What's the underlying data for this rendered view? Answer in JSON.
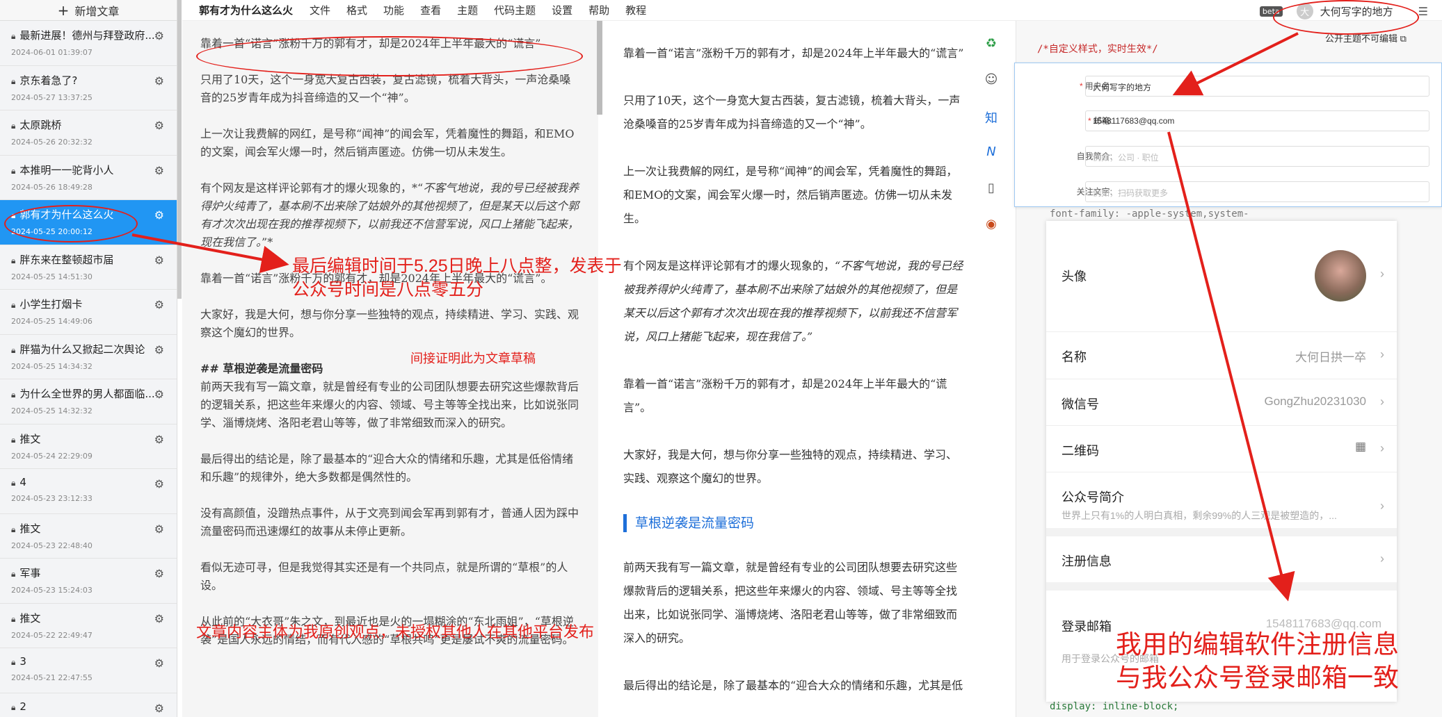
{
  "sidebar": {
    "new_article": "新增文章",
    "items": [
      {
        "title": "最新进展！德州与拜登政府...",
        "date": "2024-06-01 01:39:07",
        "active": false
      },
      {
        "title": "京东着急了?",
        "date": "2024-05-27 13:37:25",
        "active": false
      },
      {
        "title": "太原跳桥",
        "date": "2024-05-26 20:32:32",
        "active": false
      },
      {
        "title": "本推明一一驼背小人",
        "date": "2024-05-26 18:49:28",
        "active": false
      },
      {
        "title": "郭有才为什么这么火",
        "date": "2024-05-25 20:00:12",
        "active": true
      },
      {
        "title": "胖东来在整顿超市届",
        "date": "2024-05-25 14:51:30",
        "active": false
      },
      {
        "title": "小学生打烟卡",
        "date": "2024-05-25 14:49:06",
        "active": false
      },
      {
        "title": "胖猫为什么又掀起二次舆论",
        "date": "2024-05-25 14:34:32",
        "active": false
      },
      {
        "title": "为什么全世界的男人都面临...",
        "date": "2024-05-25 14:32:32",
        "active": false
      },
      {
        "title": "推文",
        "date": "2024-05-24 22:29:09",
        "active": false
      },
      {
        "title": "4",
        "date": "2024-05-23 23:12:33",
        "active": false
      },
      {
        "title": "推文",
        "date": "2024-05-23 22:48:40",
        "active": false
      },
      {
        "title": "军事",
        "date": "2024-05-23 15:24:03",
        "active": false
      },
      {
        "title": "推文",
        "date": "2024-05-22 22:49:47",
        "active": false
      },
      {
        "title": "3",
        "date": "2024-05-21 22:47:55",
        "active": false
      },
      {
        "title": "2",
        "date": "",
        "active": false
      }
    ]
  },
  "menubar": {
    "doc_title": "郭有才为什么这么火",
    "menus": [
      "文件",
      "格式",
      "功能",
      "查看",
      "主题",
      "代码主题",
      "设置",
      "帮助",
      "教程"
    ],
    "beta": "beta",
    "avatar_char": "大",
    "username": "大何写字的地方"
  },
  "editor": {
    "p1": "靠着一首“诺言”涨粉千万的郭有才，却是2024年上半年最大的“谎言”",
    "p2": "只用了10天，这个一身宽大复古西装，复古滤镜，梳着大背头，一声沧桑嗓音的25岁青年成为抖音缔造的又一个“神”。",
    "p3": "上一次让我费解的网红，是号称“闻神”的闻会军，凭着魔性的舞蹈，和EMO的文案，闻会军火爆一时，然后销声匿迹。仿佛一切从未发生。",
    "p4a": "有个网友是这样评论郭有才的爆火现象的，*“",
    "p4b": "不客气地说，我的号已经被我养得炉火纯青了，基本刷不出来除了姑娘外的其他视频了，但是某天以后这个郭有才次次出现在我的推荐视频下，以前我还不信营军说，风口上猪能飞起来，现在我信了。",
    "p4c": "”*",
    "p5": "靠着一首“诺言”涨粉千万的郭有才，却是2024年上半年最大的“谎言”。",
    "p6": "大家好，我是大何，想与你分享一些独特的观点，持续精进、学习、实践、观察这个魔幻的世界。",
    "h2": "##  草根逆袭是流量密码",
    "p7": "前两天我有写一篇文章，就是曾经有专业的公司团队想要去研究这些爆款背后的逻辑关系，把这些年来爆火的内容、领域、号主等等全找出来，比如说张同学、淄博烧烤、洛阳老君山等等，做了非常细致而深入的研究。",
    "p8": "最后得出的结论是，除了最基本的“迎合大众的情绪和乐趣，尤其是低俗情绪和乐趣”的规律外，绝大多数都是偶然性的。",
    "p9": "没有高颜值，没蹭热点事件，从于文亮到闻会军再到郭有才，普通人因为踩中流量密码而迅速爆红的故事从未停止更新。",
    "p10": "看似无迹可寻，但是我觉得其实还是有一个共同点，就是所谓的“草根”的人设。",
    "p11": "从此前的“大衣哥”朱之文，到最近也是火的一塌糊涂的“东北雨姐”，“草根逆袭”是国人永远的情结，而有代入感的“草根共鸣”更是屡试不爽的流量密码。"
  },
  "preview": {
    "p1": "靠着一首“诺言”涨粉千万的郭有才，却是2024年上半年最大的“谎言”",
    "p2": "只用了10天，这个一身宽大复古西装，复古滤镜，梳着大背头，一声沧桑嗓音的25岁青年成为抖音缔造的又一个“神”。",
    "p3": "上一次让我费解的网红，是号称“闻神”的闻会军，凭着魔性的舞蹈，和EMO的文案，闻会军火爆一时，然后销声匿迹。仿佛一切从未发生。",
    "p4a": "有个网友是这样评论郭有才的爆火现象的，",
    "p4b": "“不客气地说，我的号已经被我养得炉火纯青了，基本刷不出来除了姑娘外的其他视频了，但是某天以后这个郭有才次次出现在我的推荐视频下，以前我还不信营军说，风口上猪能飞起来，现在我信了。”",
    "p5": "靠着一首“诺言”涨粉千万的郭有才，却是2024年上半年最大的“谎言”。",
    "p6": "大家好，我是大何，想与你分享一些独特的观点，持续精进、学习、实践、观察这个魔幻的世界。",
    "h3": "草根逆袭是流量密码",
    "p7": "前两天我有写一篇文章，就是曾经有专业的公司团队想要去研究这些爆款背后的逻辑关系，把这些年来爆火的内容、领域、号主等等全找出来，比如说张同学、淄博烧烤、洛阳老君山等等，做了非常细致而深入的研究。",
    "p8": "最后得出的结论是，除了最基本的“迎合大众的情绪和乐趣，尤其是低"
  },
  "side_icons": [
    "♻",
    "☺",
    "知",
    "N",
    "▯",
    "◉"
  ],
  "css_panel": {
    "comment": "/*自定义样式，实时生效*/",
    "public_note": "公开主题不可编辑",
    "code1": "font-family: -apple-system,system-",
    "code2": "display: inline-block;"
  },
  "form": {
    "username_label": "用户名:",
    "username_value": "大何写字的地方",
    "email_label": "邮箱:",
    "email_value": "1548117683@qq.com",
    "bio_label": "自我简介:",
    "bio_placeholder": "例如，公司 · 职位",
    "follow_label": "关注文字:",
    "follow_placeholder": "例如，扫码获取更多"
  },
  "wechat": {
    "avatar_label": "头像",
    "name_label": "名称",
    "name_value": "大何日拱一卒",
    "wxid_label": "微信号",
    "wxid_value": "GongZhu20231030",
    "qrcode_label": "二维码",
    "intro_label": "公众号简介",
    "intro_value": "世界上只有1%的人明白真相，剩余99%的人三观是被塑造的，...",
    "reg_label": "注册信息",
    "login_label": "登录邮箱",
    "login_value": "1548117683@qq.com",
    "login_note": "用于登录公众号的邮箱"
  },
  "annotations": {
    "a1_line1": "最后编辑时间于5.25日晚上八点整，发表于",
    "a1_line2": "公众号时间是八点零五分",
    "a2": "间接证明此为文章草稿",
    "a3": "文章内容主体为我原创观点，未授权其他人在其他平台发布",
    "a4_line1": "我用的编辑软件注册信息",
    "a4_line2": "与我公众号登录邮箱一致",
    "color": "#e3201b"
  }
}
